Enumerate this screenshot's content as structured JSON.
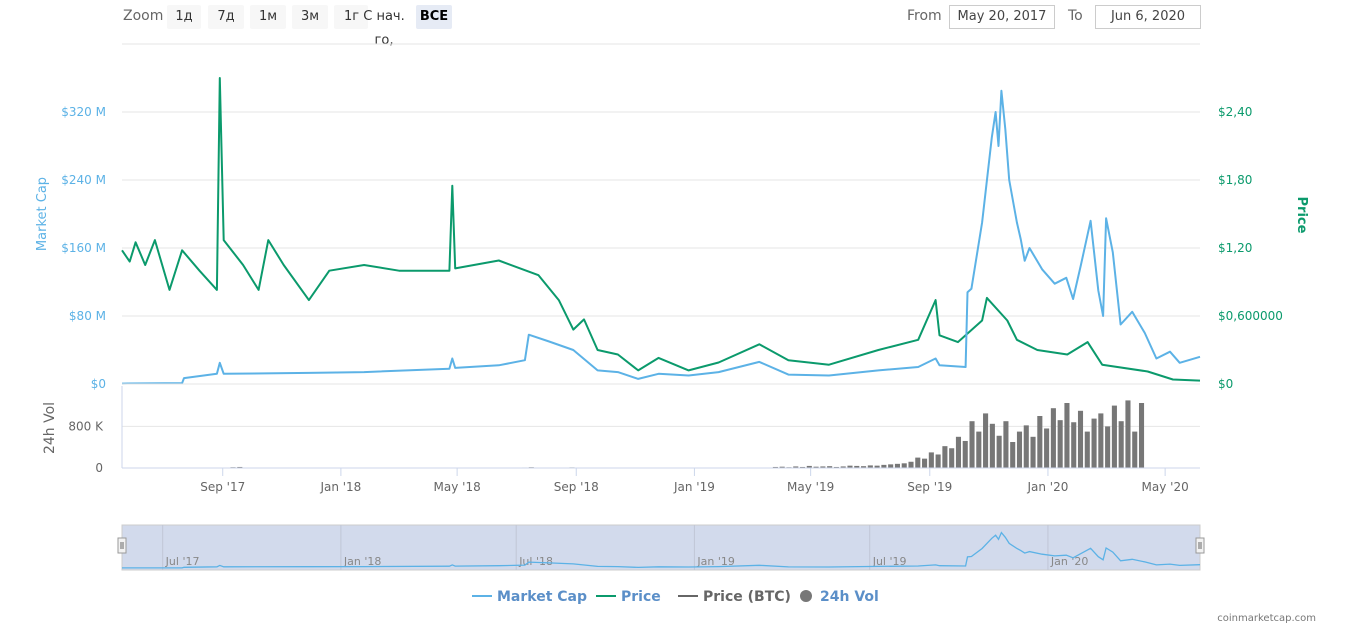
{
  "toolbar": {
    "zoom_label": "Zoom",
    "buttons": [
      "1д",
      "7д",
      "1м",
      "3м",
      "1г",
      "С нач. го,",
      "ВСЕ"
    ],
    "selected": "ВСЕ",
    "from_label": "From",
    "from_value": "May 20, 2017",
    "to_label": "To",
    "to_value": "Jun 6, 2020"
  },
  "colors": {
    "market_cap": "#5cb2e6",
    "price": "#0b9a6c",
    "price_btc": "#666666",
    "volume": "#777777",
    "navigator_fill": "#d2daec"
  },
  "chart_data": {
    "type": "line",
    "x_range": [
      "2017-05-20",
      "2020-06-06"
    ],
    "x_ticks": [
      {
        "date": "2017-09-01",
        "label": "Sep '17"
      },
      {
        "date": "2018-01-01",
        "label": "Jan '18"
      },
      {
        "date": "2018-05-01",
        "label": "May '18"
      },
      {
        "date": "2018-09-01",
        "label": "Sep '18"
      },
      {
        "date": "2019-01-01",
        "label": "Jan '19"
      },
      {
        "date": "2019-05-01",
        "label": "May '19"
      },
      {
        "date": "2019-09-01",
        "label": "Sep '19"
      },
      {
        "date": "2020-01-01",
        "label": "Jan '20"
      },
      {
        "date": "2020-05-01",
        "label": "May '20"
      }
    ],
    "left_axis": {
      "title": "Market Cap",
      "range": [
        0,
        400
      ],
      "ticks": [
        {
          "v": 0,
          "label": "$0"
        },
        {
          "v": 80,
          "label": "$80 M"
        },
        {
          "v": 160,
          "label": "$160 M"
        },
        {
          "v": 240,
          "label": "$240 M"
        },
        {
          "v": 320,
          "label": "$320 M"
        }
      ]
    },
    "right_axis": {
      "title": "Price",
      "range": [
        0,
        3.0
      ],
      "ticks": [
        {
          "v": 0,
          "label": "$0"
        },
        {
          "v": 0.6,
          "label": "$0,600000"
        },
        {
          "v": 1.2,
          "label": "$1,20"
        },
        {
          "v": 1.8,
          "label": "$1,80"
        },
        {
          "v": 2.4,
          "label": "$2,40"
        }
      ]
    },
    "volume_axis": {
      "title": "24h Vol",
      "range": [
        0,
        1500
      ],
      "ticks": [
        {
          "v": 0,
          "label": "0"
        },
        {
          "v": 800,
          "label": "800 K"
        }
      ]
    },
    "navigator_ticks": [
      {
        "date": "2017-07-01",
        "label": "Jul '17"
      },
      {
        "date": "2018-01-01",
        "label": "Jan '18"
      },
      {
        "date": "2018-07-01",
        "label": "Jul '18"
      },
      {
        "date": "2019-01-01",
        "label": "Jan '19"
      },
      {
        "date": "2019-07-01",
        "label": "Jul '19"
      },
      {
        "date": "2020-01-01",
        "label": "Jan '20"
      }
    ],
    "legend": [
      {
        "name": "Market Cap",
        "symbol": "line"
      },
      {
        "name": "Price",
        "symbol": "line"
      },
      {
        "name": "Price (BTC)",
        "symbol": "line"
      },
      {
        "name": "24h Vol",
        "symbol": "circle"
      }
    ],
    "series": [
      {
        "name": "Market Cap",
        "unit": "USD millions",
        "points": [
          [
            "2017-05-20",
            0.5
          ],
          [
            "2017-07-21",
            1
          ],
          [
            "2017-07-23",
            7
          ],
          [
            "2017-08-26",
            12
          ],
          [
            "2017-08-29",
            25
          ],
          [
            "2017-09-02",
            12
          ],
          [
            "2017-11-29",
            13
          ],
          [
            "2018-01-25",
            14
          ],
          [
            "2018-04-23",
            18
          ],
          [
            "2018-04-26",
            30
          ],
          [
            "2018-04-29",
            19
          ],
          [
            "2018-06-13",
            22
          ],
          [
            "2018-07-10",
            28
          ],
          [
            "2018-07-14",
            58
          ],
          [
            "2018-08-04",
            50
          ],
          [
            "2018-08-29",
            40
          ],
          [
            "2018-09-23",
            16
          ],
          [
            "2018-10-14",
            14
          ],
          [
            "2018-11-04",
            6
          ],
          [
            "2018-11-25",
            12
          ],
          [
            "2018-12-26",
            10
          ],
          [
            "2019-01-26",
            14
          ],
          [
            "2019-03-09",
            26
          ],
          [
            "2019-04-08",
            11
          ],
          [
            "2019-05-20",
            10
          ],
          [
            "2019-07-10",
            16
          ],
          [
            "2019-08-20",
            20
          ],
          [
            "2019-09-07",
            30
          ],
          [
            "2019-09-11",
            22
          ],
          [
            "2019-10-08",
            20
          ],
          [
            "2019-10-10",
            108
          ],
          [
            "2019-10-14",
            112
          ],
          [
            "2019-10-25",
            190
          ],
          [
            "2019-11-04",
            290
          ],
          [
            "2019-11-08",
            320
          ],
          [
            "2019-11-11",
            280
          ],
          [
            "2019-11-14",
            345
          ],
          [
            "2019-11-18",
            300
          ],
          [
            "2019-11-22",
            240
          ],
          [
            "2019-11-30",
            190
          ],
          [
            "2019-12-04",
            170
          ],
          [
            "2019-12-08",
            145
          ],
          [
            "2019-12-13",
            160
          ],
          [
            "2019-12-26",
            135
          ],
          [
            "2020-01-08",
            118
          ],
          [
            "2020-01-20",
            125
          ],
          [
            "2020-01-27",
            100
          ],
          [
            "2020-02-04",
            140
          ],
          [
            "2020-02-14",
            192
          ],
          [
            "2020-02-22",
            110
          ],
          [
            "2020-02-27",
            80
          ],
          [
            "2020-03-01",
            195
          ],
          [
            "2020-03-08",
            155
          ],
          [
            "2020-03-16",
            70
          ],
          [
            "2020-03-28",
            85
          ],
          [
            "2020-04-10",
            60
          ],
          [
            "2020-04-22",
            30
          ],
          [
            "2020-05-06",
            38
          ],
          [
            "2020-05-16",
            25
          ],
          [
            "2020-06-06",
            32
          ]
        ]
      },
      {
        "name": "Price",
        "unit": "USD",
        "points": [
          [
            "2017-05-20",
            1.18
          ],
          [
            "2017-05-28",
            1.08
          ],
          [
            "2017-06-03",
            1.25
          ],
          [
            "2017-06-13",
            1.05
          ],
          [
            "2017-06-23",
            1.27
          ],
          [
            "2017-07-08",
            0.83
          ],
          [
            "2017-07-21",
            1.18
          ],
          [
            "2017-08-08",
            1.0
          ],
          [
            "2017-08-26",
            0.83
          ],
          [
            "2017-08-29",
            2.7
          ],
          [
            "2017-09-02",
            1.27
          ],
          [
            "2017-09-22",
            1.05
          ],
          [
            "2017-10-08",
            0.83
          ],
          [
            "2017-10-18",
            1.27
          ],
          [
            "2017-11-03",
            1.05
          ],
          [
            "2017-11-29",
            0.74
          ],
          [
            "2017-12-20",
            1.0
          ],
          [
            "2018-01-25",
            1.05
          ],
          [
            "2018-03-02",
            1.0
          ],
          [
            "2018-04-23",
            1.0
          ],
          [
            "2018-04-26",
            1.75
          ],
          [
            "2018-04-29",
            1.02
          ],
          [
            "2018-06-13",
            1.09
          ],
          [
            "2018-07-24",
            0.96
          ],
          [
            "2018-08-14",
            0.74
          ],
          [
            "2018-08-29",
            0.48
          ],
          [
            "2018-09-09",
            0.57
          ],
          [
            "2018-09-23",
            0.3
          ],
          [
            "2018-10-14",
            0.26
          ],
          [
            "2018-11-04",
            0.12
          ],
          [
            "2018-11-25",
            0.23
          ],
          [
            "2018-12-26",
            0.12
          ],
          [
            "2019-01-26",
            0.19
          ],
          [
            "2019-03-09",
            0.35
          ],
          [
            "2019-04-08",
            0.21
          ],
          [
            "2019-05-20",
            0.17
          ],
          [
            "2019-07-10",
            0.3
          ],
          [
            "2019-08-20",
            0.39
          ],
          [
            "2019-09-07",
            0.74
          ],
          [
            "2019-09-11",
            0.43
          ],
          [
            "2019-09-30",
            0.37
          ],
          [
            "2019-10-25",
            0.56
          ],
          [
            "2019-10-30",
            0.76
          ],
          [
            "2019-11-20",
            0.56
          ],
          [
            "2019-11-30",
            0.39
          ],
          [
            "2019-12-21",
            0.3
          ],
          [
            "2020-01-21",
            0.26
          ],
          [
            "2020-02-11",
            0.37
          ],
          [
            "2020-02-26",
            0.17
          ],
          [
            "2020-04-13",
            0.11
          ],
          [
            "2020-05-09",
            0.04
          ],
          [
            "2020-06-06",
            0.03
          ]
        ]
      }
    ],
    "volume": {
      "name": "24h Vol",
      "unit": "USD thousands",
      "start": "2017-05-20",
      "interval_days": 7,
      "values": [
        0,
        0,
        0,
        0,
        0,
        0,
        0,
        0,
        0,
        0,
        0,
        0,
        0,
        0,
        0,
        0,
        15,
        20,
        0,
        0,
        0,
        0,
        0,
        0,
        0,
        0,
        0,
        0,
        0,
        0,
        0,
        0,
        0,
        0,
        0,
        0,
        0,
        0,
        0,
        0,
        0,
        0,
        0,
        0,
        0,
        0,
        0,
        0,
        0,
        0,
        0,
        0,
        0,
        0,
        0,
        0,
        0,
        0,
        0,
        10,
        15,
        0,
        0,
        8,
        0,
        0,
        12,
        0,
        0,
        0,
        0,
        0,
        0,
        0,
        0,
        0,
        0,
        0,
        0,
        0,
        0,
        0,
        0,
        0,
        0,
        0,
        0,
        0,
        0,
        0,
        0,
        0,
        0,
        0,
        0,
        0,
        20,
        25,
        15,
        30,
        20,
        40,
        25,
        30,
        35,
        20,
        30,
        45,
        40,
        35,
        50,
        45,
        60,
        70,
        80,
        90,
        120,
        200,
        180,
        300,
        260,
        420,
        380,
        600,
        520,
        900,
        700,
        1050,
        850,
        620,
        900,
        500,
        700,
        820,
        600,
        1000,
        760,
        1150,
        920,
        1250,
        880,
        1100,
        700,
        950,
        1050,
        800,
        1200,
        900,
        1300,
        700,
        1250
      ]
    }
  },
  "footer": {
    "credit": "coinmarketcap.com"
  }
}
